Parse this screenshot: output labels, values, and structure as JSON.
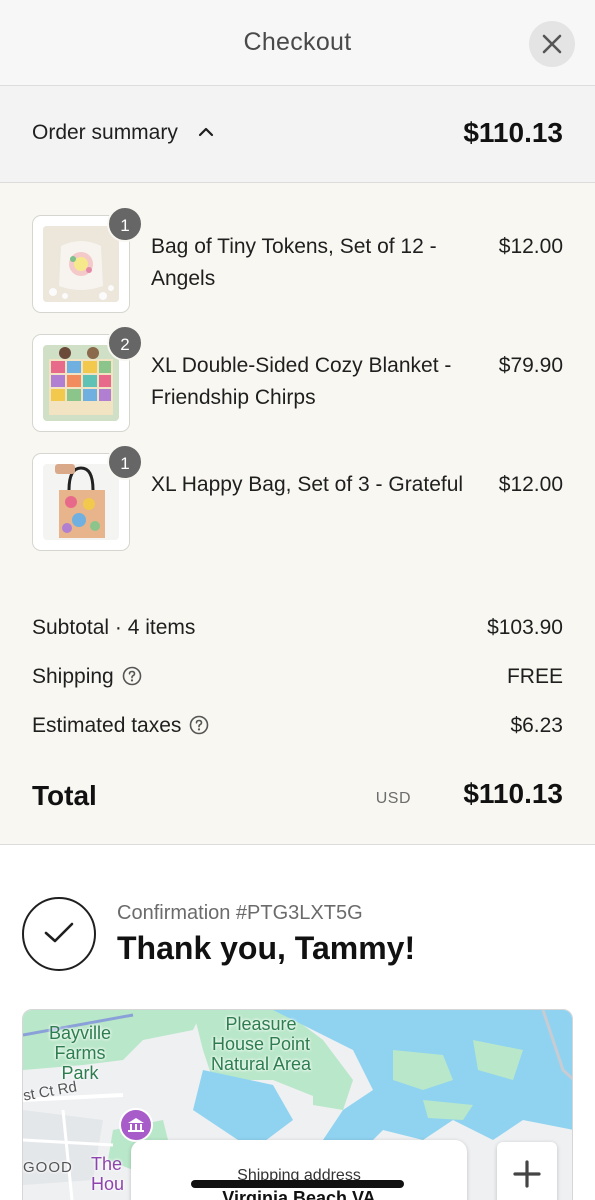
{
  "header": {
    "title": "Checkout"
  },
  "summary": {
    "label": "Order summary",
    "total": "$110.13"
  },
  "items": [
    {
      "name": "Bag of Tiny Tokens, Set of 12 - Angels",
      "price": "$12.00",
      "quantity": "1"
    },
    {
      "name": "XL Double-Sided Cozy Blanket - Friendship Chirps",
      "price": "$79.90",
      "quantity": "2"
    },
    {
      "name": "XL Happy Bag, Set of 3 - Grateful",
      "price": "$12.00",
      "quantity": "1"
    }
  ],
  "totals": {
    "subtotal_label": "Subtotal · 4 items",
    "subtotal_value": "$103.90",
    "shipping_label": "Shipping",
    "shipping_value": "FREE",
    "taxes_label": "Estimated taxes",
    "taxes_value": "$6.23",
    "total_label": "Total",
    "currency": "USD",
    "total_value": "$110.13"
  },
  "confirmation": {
    "number": "Confirmation #PTG3LXT5G",
    "title": "Thank you, Tammy!"
  },
  "map": {
    "labels": {
      "bayville": "Bayville Farms Park",
      "pleasure": "Pleasure House Point Natural Area",
      "street": "st Ct Rd",
      "good": "GOOD",
      "the_hou": "The Hou"
    },
    "card_title": "Shipping address",
    "card_subtitle": "Virginia Beach VA"
  },
  "colors": {
    "header_bg": "#f7f7f7",
    "summary_bg": "#f8f7f2",
    "badge": "#666666",
    "water": "#8fd3f0",
    "park": "#b9e7c9"
  }
}
